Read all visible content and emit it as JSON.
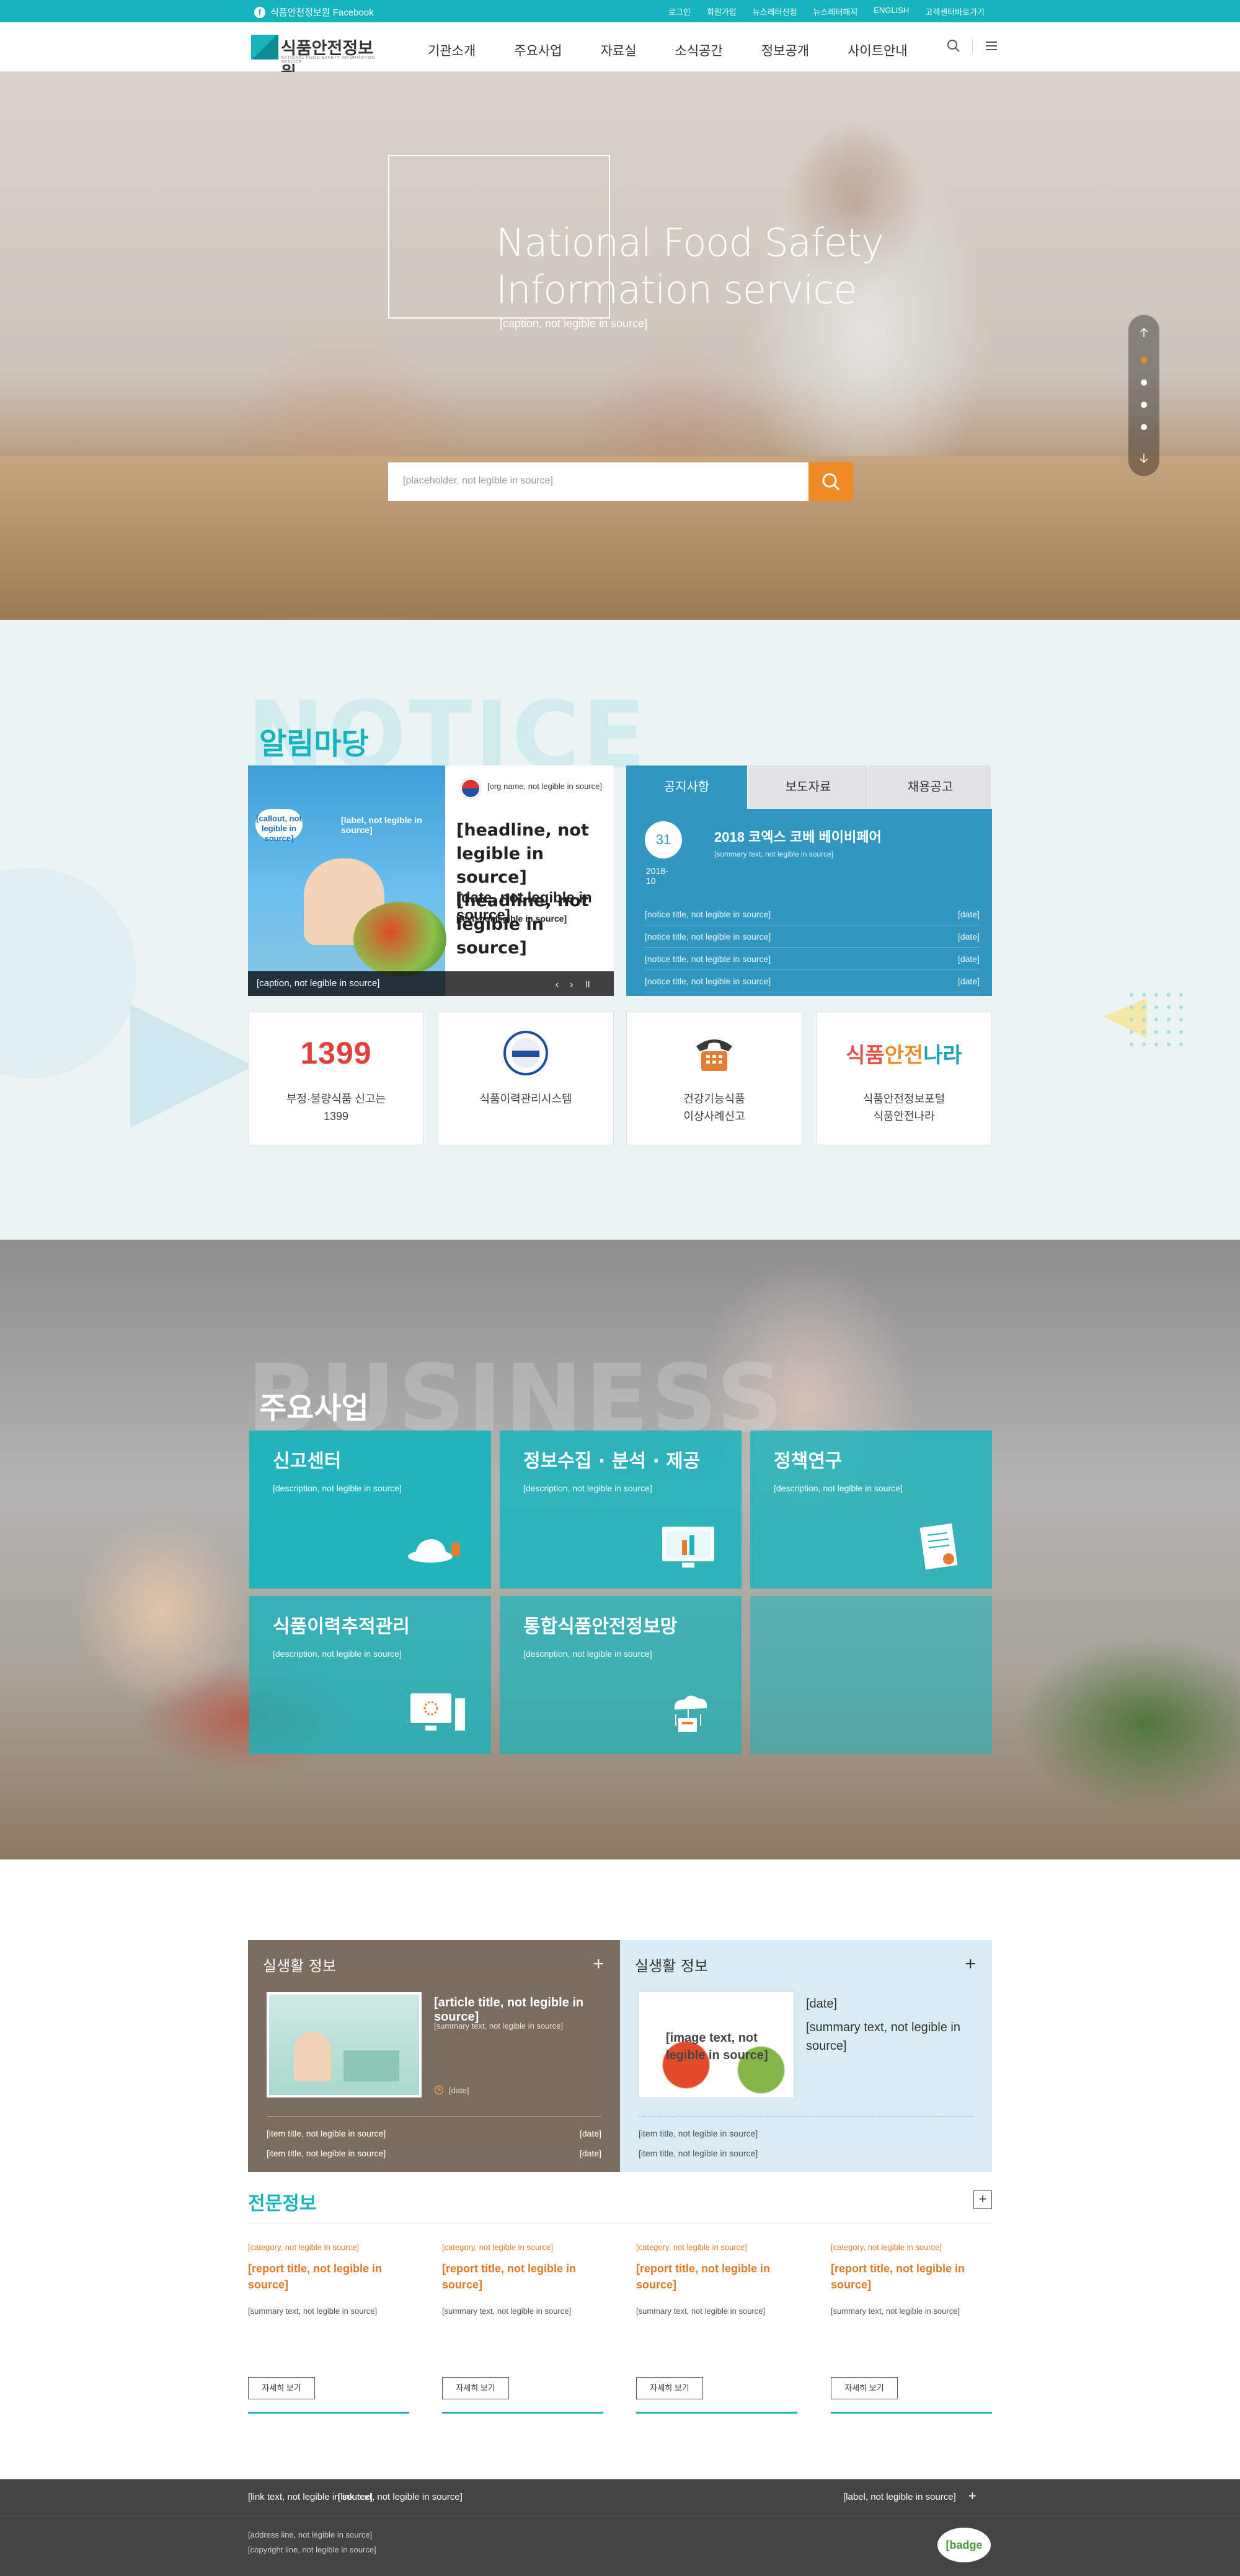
{
  "topbar": {
    "facebook": "식품안전정보원 Facebook",
    "util": [
      "로그인",
      "회원가입",
      "뉴스레터신청",
      "뉴스레터해지",
      "ENGLISH",
      "고객센터바로가기"
    ]
  },
  "header": {
    "logo_title": "식품안전정보원",
    "logo_sub": "NATIONAL FOOD SAFETY INFORMATION SERVICE",
    "nav": [
      "기관소개",
      "주요사업",
      "자료실",
      "소식공간",
      "정보공개",
      "사이트안내"
    ]
  },
  "hero": {
    "title_line1": "National Food Safety",
    "title_line2": "Information service",
    "subtitle": "[caption, not legible in source]",
    "search_placeholder": "[placeholder, not legible in source]"
  },
  "notice": {
    "bg_word": "NOTICE",
    "title": "알림마당",
    "banner": {
      "bubble": "[callout, not legible in source]",
      "pls": "[label, not legible in source]",
      "org": "[org name, not legible in source]",
      "headline1": "[headline, not legible in source]",
      "headline2": "[headline, not legible in source]",
      "date": "[date, not legible in source]",
      "desc": "[text, not legible in source]",
      "caption": "[caption, not legible in source]"
    },
    "tabs": [
      "공지사항",
      "보도자료",
      "채용공고"
    ],
    "featured": {
      "day": "31",
      "ym": "2018-10",
      "title": "2018 코엑스 코베 베이비페어",
      "desc": "[summary text, not legible in source]"
    },
    "list": [
      {
        "title": "[notice title, not legible in source]",
        "date": "[date]"
      },
      {
        "title": "[notice title, not legible in source]",
        "date": "[date]"
      },
      {
        "title": "[notice title, not legible in source]",
        "date": "[date]"
      },
      {
        "title": "[notice title, not legible in source]",
        "date": "[date]"
      }
    ],
    "quick": [
      {
        "icon": "1399",
        "label1": "부정·불량식품 신고는",
        "label2": "1399"
      },
      {
        "icon": "traceability-logo",
        "label1": "식품이력관리시스템",
        "label2": ""
      },
      {
        "icon": "phone-icon",
        "label1": "건강기능식품",
        "label2": "이상사례신고"
      },
      {
        "icon": "식품안전나라",
        "label1": "식품안전정보포털",
        "label2": "식품안전나라"
      }
    ]
  },
  "business": {
    "bg_word": "BUSINESS",
    "title": "주요사업",
    "cards": [
      {
        "title": "신고센터",
        "desc": "[description, not legible in source]",
        "color": "#16b4bd"
      },
      {
        "title": "정보수집 · 분석 · 제공",
        "desc": "[description, not legible in source]",
        "color": "#16b4bd"
      },
      {
        "title": "정책연구",
        "desc": "[description, not legible in source]",
        "color": "#16b4bd"
      },
      {
        "title": "식품이력추적관리",
        "desc": "[description, not legible in source]",
        "color": "#16b4bd"
      },
      {
        "title": "통합식품안전정보망",
        "desc": "[description, not legible in source]",
        "color": "#16b4bd"
      }
    ]
  },
  "life": {
    "title": "실생활 정보",
    "article_title": "[article title, not legible in source]",
    "article_desc": "[summary text, not legible in source]",
    "article_date": "[date]",
    "list": [
      {
        "title": "[item title, not legible in source]",
        "date": "[date]"
      },
      {
        "title": "[item title, not legible in source]",
        "date": "[date]"
      }
    ]
  },
  "life2": {
    "title": "실생활 정보",
    "thumb_title": "[image text, not legible in source]",
    "date_title": "[date]",
    "desc": "[summary text, not legible in source]",
    "list": [
      "[item title, not legible in source]",
      "[item title, not legible in source]"
    ]
  },
  "expert": {
    "title": "전문정보",
    "more": "자세히 보기",
    "cols": [
      {
        "cat": "[category, not legible in source]",
        "title": "[report title, not legible in source]",
        "body": "[summary text, not legible in source]"
      },
      {
        "cat": "[category, not legible in source]",
        "title": "[report title, not legible in source]",
        "body": "[summary text, not legible in source]"
      },
      {
        "cat": "[category, not legible in source]",
        "title": "[report title, not legible in source]",
        "body": "[summary text, not legible in source]"
      },
      {
        "cat": "[category, not legible in source]",
        "title": "[report title, not legible in source]",
        "body": "[summary text, not legible in source]"
      }
    ]
  },
  "footer": {
    "links": [
      "[link text, not legible in source]",
      "[link text, not legible in source]"
    ],
    "related": "[label, not legible in source]",
    "address": "[address line, not legible in source]",
    "copyright": "[copyright line, not legible in source]",
    "badge": "[badge text, not legible in source]"
  }
}
